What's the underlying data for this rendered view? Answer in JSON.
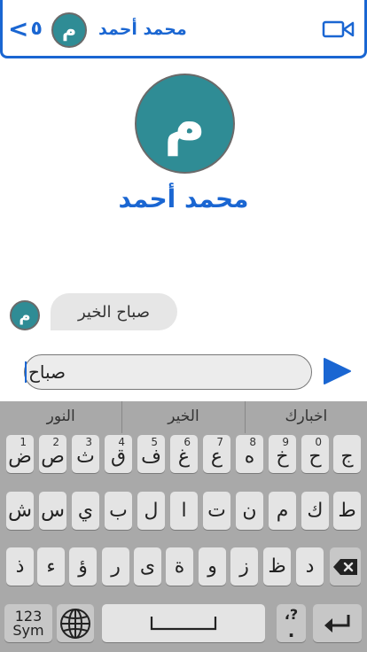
{
  "header": {
    "back_chevron": "<",
    "back_count": "٥",
    "avatar_letter": "م",
    "contact_name": "محمد أحمد",
    "video_icon": "video-camera-icon"
  },
  "profile": {
    "avatar_letter": "م",
    "name": "محمد أحمد"
  },
  "messages": [
    {
      "avatar_letter": "م",
      "text": "صباح الخير"
    }
  ],
  "composer": {
    "value": "صباح",
    "send_icon": "send-arrow-icon"
  },
  "keyboard": {
    "suggestions": [
      "النور",
      "الخير",
      "اخبارك"
    ],
    "row1": [
      {
        "char": "ض",
        "hint": "1"
      },
      {
        "char": "ص",
        "hint": "2"
      },
      {
        "char": "ث",
        "hint": "3"
      },
      {
        "char": "ق",
        "hint": "4"
      },
      {
        "char": "ف",
        "hint": "5"
      },
      {
        "char": "غ",
        "hint": "6"
      },
      {
        "char": "ع",
        "hint": "7"
      },
      {
        "char": "ه",
        "hint": "8"
      },
      {
        "char": "خ",
        "hint": "9"
      },
      {
        "char": "ح",
        "hint": "0"
      },
      {
        "char": "ج",
        "hint": ""
      }
    ],
    "row2": [
      "ش",
      "س",
      "ي",
      "ب",
      "ل",
      "ا",
      "ت",
      "ن",
      "م",
      "ك",
      "ط"
    ],
    "row3": [
      "ذ",
      "ء",
      "ؤ",
      "ر",
      "ى",
      "ة",
      "و",
      "ز",
      "ظ",
      "د"
    ],
    "sym_label_1": "123",
    "sym_label_2": "Sym",
    "punct_top": "،?",
    "punct_bottom": ".",
    "globe_icon": "globe-icon",
    "backspace_icon": "backspace-icon",
    "space_icon": "space-bar-icon",
    "enter_icon": "return-arrow-icon"
  },
  "colors": {
    "accent": "#1a66d2",
    "avatar_bg": "#2f8c95",
    "keyboard_bg": "#a9a9a9",
    "key_bg": "#e4e4e4"
  }
}
